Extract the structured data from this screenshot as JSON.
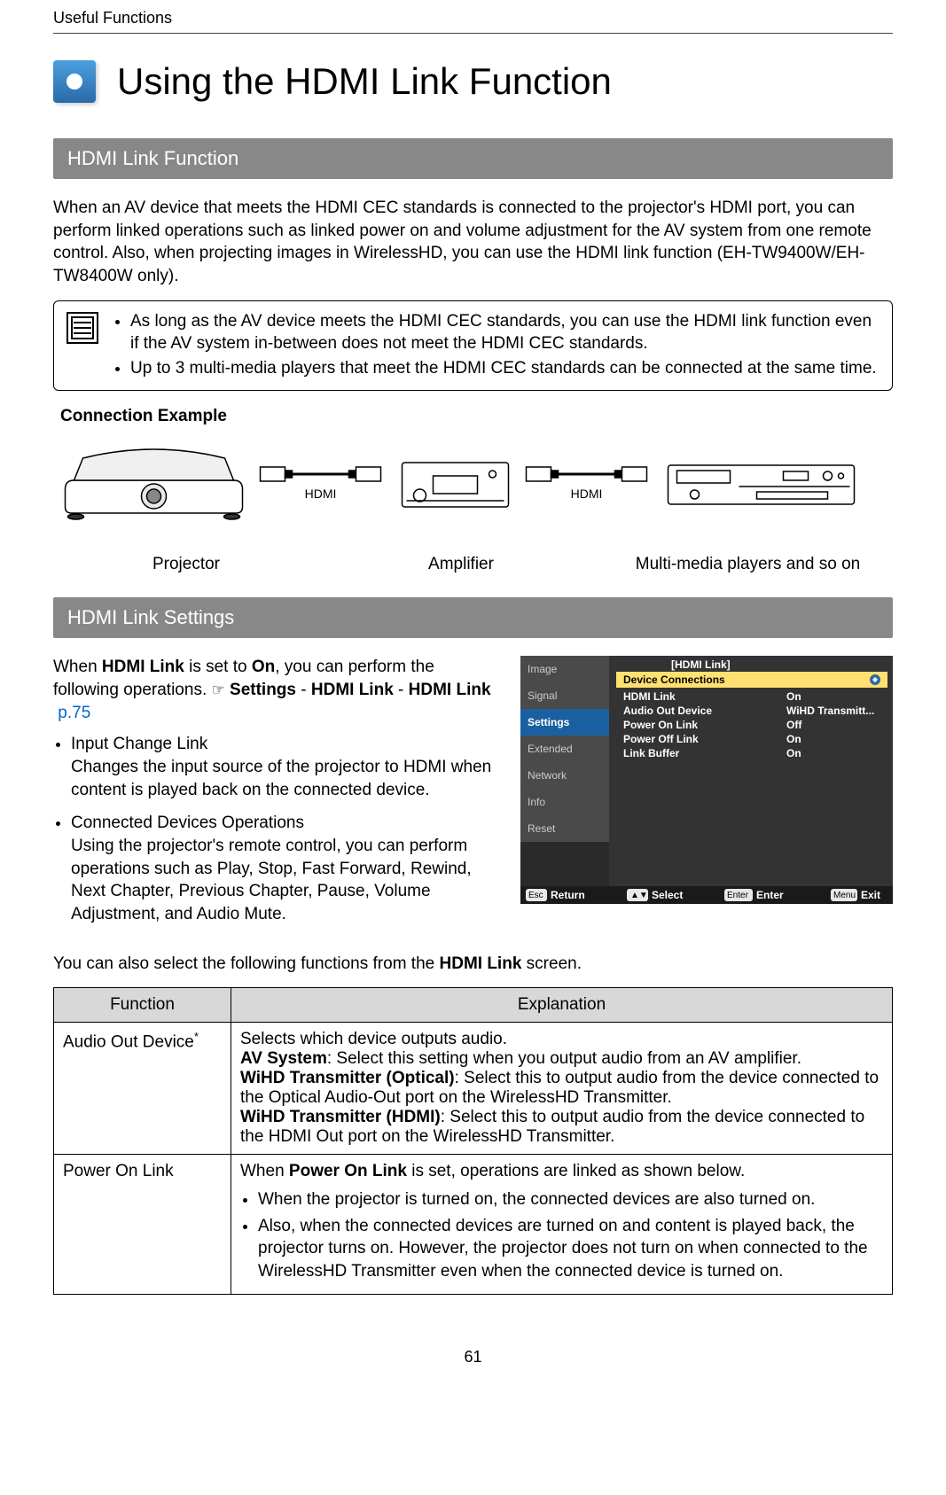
{
  "running_head": "Useful Functions",
  "page_title": "Using the HDMI Link Function",
  "page_number": "61",
  "section1": {
    "heading": "HDMI Link Function",
    "intro": "When an AV device that meets the HDMI CEC standards is connected to the projector's HDMI port, you can perform linked operations such as linked power on and volume adjustment for the AV system from one remote control. Also, when projecting images in WirelessHD, you can use the HDMI link function (EH-TW9400W/EH-TW8400W only).",
    "notes": [
      "As long as the AV device meets the HDMI CEC standards, you can use the HDMI link function even if the AV system in-between does not meet the HDMI CEC standards.",
      "Up to 3 multi-media players that meet the HDMI CEC standards can be connected at the same time."
    ],
    "connection": {
      "heading": "Connection Example",
      "labels": {
        "hdmi": "HDMI",
        "projector": "Projector",
        "amplifier": "Amplifier",
        "players": "Multi-media players and so on"
      }
    }
  },
  "section2": {
    "heading": "HDMI Link Settings",
    "intro_prefix": "When ",
    "intro_bold1": "HDMI Link",
    "intro_mid1": " is set to ",
    "intro_bold2": "On",
    "intro_mid2": ", you can perform the following operations. ",
    "pointer": "☞",
    "path_settings": "Settings",
    "path_sep": " - ",
    "path_hdmi_link1": "HDMI Link",
    "path_hdmi_link2": "HDMI Link",
    "page_ref": "p.75",
    "ops": [
      {
        "title": "Input Change Link",
        "body": "Changes the input source of the projector to HDMI when content is played back on the connected device."
      },
      {
        "title": "Connected Devices Operations",
        "body": "Using the projector's remote control, you can perform operations such as Play, Stop, Fast Forward, Rewind, Next Chapter, Previous Chapter, Pause, Volume Adjustment, and Audio Mute."
      }
    ],
    "sub_intro_prefix": "You can also select the following functions from the ",
    "sub_intro_bold": "HDMI Link",
    "sub_intro_suffix": " screen.",
    "menu": {
      "tabs": [
        "Image",
        "Signal",
        "Settings",
        "Extended",
        "Network",
        "Info",
        "Reset"
      ],
      "selected_tab": "Settings",
      "panel_title": "[HDMI Link]",
      "selected_row": "Device Connections",
      "rows": [
        {
          "label": "HDMI Link",
          "value": "On"
        },
        {
          "label": "Audio Out Device",
          "value": "WiHD Transmitt..."
        },
        {
          "label": "Power On Link",
          "value": "Off"
        },
        {
          "label": "Power Off Link",
          "value": "On"
        },
        {
          "label": "Link Buffer",
          "value": "On"
        }
      ],
      "footer": {
        "return_key": "Esc",
        "return_label": "Return",
        "select_key": "▲▼",
        "select_label": "Select",
        "enter_key": "Enter",
        "enter_label": "Enter",
        "exit_key": "Menu",
        "exit_label": "Exit"
      }
    },
    "table": {
      "headers": [
        "Function",
        "Explanation"
      ],
      "rows": [
        {
          "func": "Audio Out Device",
          "func_sup": "*",
          "lines": {
            "l1": "Selects which device outputs audio.",
            "b1": "AV System",
            "l2": ": Select this setting when you output audio from an AV amplifier.",
            "b2": "WiHD Transmitter (Optical)",
            "l3": ": Select this to output audio from the device connected to the Optical Audio-Out port on the WirelessHD Transmitter.",
            "b3": "WiHD Transmitter (HDMI)",
            "l4": ": Select this to output audio from the device connected to the HDMI Out port on the WirelessHD Transmitter."
          }
        },
        {
          "func": "Power On Link",
          "intro_prefix": "When ",
          "intro_bold": "Power On Link",
          "intro_suffix": " is set, operations are linked as shown below.",
          "bullets": [
            "When the projector is turned on, the connected devices are also turned on.",
            "Also, when the connected devices are turned on and content is played back, the projector turns on. However, the projector does not turn on when connected to the WirelessHD Transmitter even when the connected device is turned on."
          ]
        }
      ]
    }
  }
}
